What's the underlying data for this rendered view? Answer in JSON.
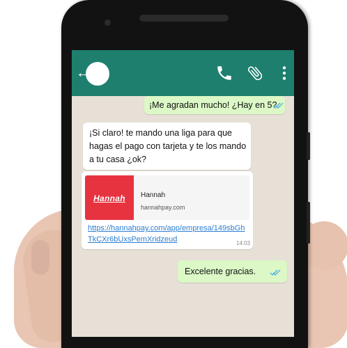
{
  "colors": {
    "header": "#1e7f6e",
    "chat_background": "#e6e0d6",
    "outgoing_bubble": "#dcf8c6",
    "incoming_bubble": "#ffffff",
    "link": "#2b7fd1",
    "brand_red": "#e6333f",
    "read_tick": "#4fb0e0"
  },
  "header": {
    "back_icon": "back-arrow-icon",
    "avatar": "avatar",
    "icons": [
      "phone-icon",
      "paperclip-icon",
      "more-vert-icon"
    ]
  },
  "messages": [
    {
      "direction": "outgoing",
      "text": "¡Me agradan mucho! ¿Hay en 5?",
      "status": "read"
    },
    {
      "direction": "incoming",
      "text": "¡Si claro! te mando una liga para que hagas el pago con tarjeta y te los mando a tu casa ¿ok?"
    },
    {
      "direction": "incoming",
      "preview": {
        "logo_text": "Hannah",
        "title": "Hannah",
        "domain": "hannahpay.com"
      },
      "link": "https://hannahpay.com/app/empresa/149sbGhTkCXr6bUxsPemXridzeud",
      "time": "14:03"
    },
    {
      "direction": "outgoing",
      "text": "Excelente gracias.",
      "status": "read"
    }
  ]
}
